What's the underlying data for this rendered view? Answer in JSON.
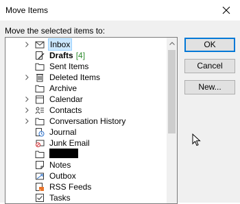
{
  "window": {
    "title": "Move Items",
    "close_icon": "close-icon"
  },
  "prompt": "Move the selected items to:",
  "tree": {
    "items": [
      {
        "label": "Inbox",
        "icon": "inbox-icon",
        "expandable": true,
        "selected": true
      },
      {
        "label": "Drafts",
        "count": "[4]",
        "icon": "drafts-icon",
        "bold": true
      },
      {
        "label": "Sent Items",
        "icon": "folder-icon"
      },
      {
        "label": "Deleted Items",
        "icon": "trash-icon",
        "expandable": true
      },
      {
        "label": "Archive",
        "icon": "folder-icon"
      },
      {
        "label": "Calendar",
        "icon": "calendar-icon",
        "expandable": true
      },
      {
        "label": "Contacts",
        "icon": "contacts-icon",
        "expandable": true
      },
      {
        "label": "Conversation History",
        "icon": "folder-icon",
        "expandable": true
      },
      {
        "label": "Journal",
        "icon": "journal-icon"
      },
      {
        "label": "Junk Email",
        "icon": "junk-icon"
      },
      {
        "label": "",
        "icon": "folder-icon",
        "redacted": true
      },
      {
        "label": "Notes",
        "icon": "notes-icon"
      },
      {
        "label": "Outbox",
        "icon": "outbox-icon"
      },
      {
        "label": "RSS Feeds",
        "icon": "rss-icon"
      },
      {
        "label": "Tasks",
        "icon": "tasks-icon"
      }
    ]
  },
  "buttons": {
    "ok": "OK",
    "cancel": "Cancel",
    "new": "New..."
  },
  "colors": {
    "selection": "#cce8ff",
    "accent": "#0078d7",
    "count": "#2e8b2e"
  }
}
